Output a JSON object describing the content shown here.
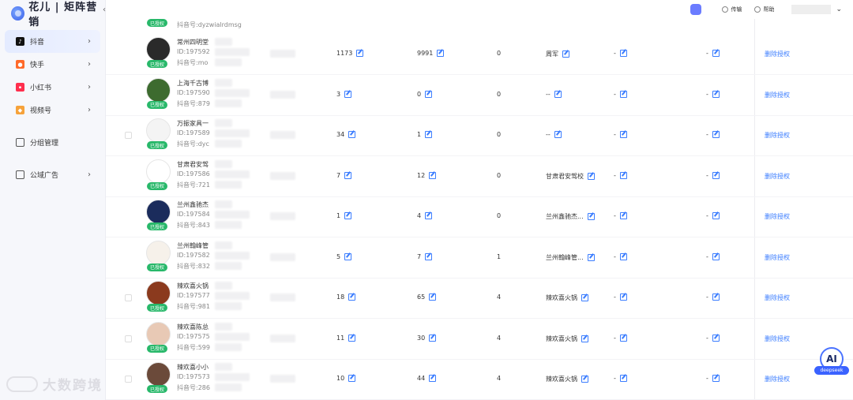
{
  "brand": {
    "name": "花儿 | 矩阵营销"
  },
  "sidebar": {
    "items": [
      {
        "label": "抖音",
        "icon": "douyin-icon",
        "active": true
      },
      {
        "label": "快手",
        "icon": "kuaishou-icon",
        "active": false
      },
      {
        "label": "小红书",
        "icon": "xiaohongshu-icon",
        "active": false
      },
      {
        "label": "视频号",
        "icon": "video-channel-icon",
        "active": false
      },
      {
        "label": "分组管理",
        "icon": "group-icon",
        "active": false
      },
      {
        "label": "公域广告",
        "icon": "ad-icon",
        "active": false
      }
    ]
  },
  "header": {
    "btn1": "传输",
    "btn2": "帮助"
  },
  "table": {
    "top_partial": {
      "badge": "已授权",
      "dy": "抖音号:dyzwialrdmsg"
    },
    "rows": [
      {
        "nick": "常州四明堂",
        "id": "ID:197592",
        "dy": "抖音号:mo",
        "c1": "1173",
        "c2": "9991",
        "c3": "0",
        "c4": "周军",
        "c5": "-",
        "c6": "-",
        "badge": "已授权",
        "action": "删除授权"
      },
      {
        "nick": "上海千古博",
        "id": "ID:197590",
        "dy": "抖音号:879",
        "c1": "3",
        "c2": "0",
        "c3": "0",
        "c4": "--",
        "c5": "-",
        "c6": "-",
        "badge": "已授权",
        "action": "删除授权"
      },
      {
        "nick": "万振家具一",
        "id": "ID:197589",
        "dy": "抖音号:dyc",
        "c1": "34",
        "c2": "1",
        "c3": "0",
        "c4": "--",
        "c5": "-",
        "c6": "-",
        "badge": "已授权",
        "action": "删除授权"
      },
      {
        "nick": "甘肃君安驾",
        "id": "ID:197586",
        "dy": "抖音号:721",
        "c1": "7",
        "c2": "12",
        "c3": "0",
        "c4": "甘肃君安驾校",
        "c5": "-",
        "c6": "-",
        "badge": "已授权",
        "action": "删除授权"
      },
      {
        "nick": "兰州鑫驰杰",
        "id": "ID:197584",
        "dy": "抖音号:843",
        "c1": "1",
        "c2": "4",
        "c3": "0",
        "c4": "兰州鑫驰杰...",
        "c5": "-",
        "c6": "-",
        "badge": "已授权",
        "action": "删除授权"
      },
      {
        "nick": "兰州翰峰管",
        "id": "ID:197582",
        "dy": "抖音号:832",
        "c1": "5",
        "c2": "7",
        "c3": "1",
        "c4": "兰州翰峰管...",
        "c5": "-",
        "c6": "-",
        "badge": "已授权",
        "action": "删除授权"
      },
      {
        "nick": "辣欢喜火锅",
        "id": "ID:197577",
        "dy": "抖音号:981",
        "c1": "18",
        "c2": "65",
        "c3": "4",
        "c4": "辣欢喜火锅",
        "c5": "-",
        "c6": "-",
        "badge": "已授权",
        "action": "删除授权"
      },
      {
        "nick": "辣欢喜陈总",
        "id": "ID:197575",
        "dy": "抖音号:599",
        "c1": "11",
        "c2": "30",
        "c3": "4",
        "c4": "辣欢喜火锅",
        "c5": "-",
        "c6": "-",
        "badge": "已授权",
        "action": "删除授权"
      },
      {
        "nick": "辣欢喜小小",
        "id": "ID:197573",
        "dy": "抖音号:286",
        "c1": "10",
        "c2": "44",
        "c3": "4",
        "c4": "辣欢喜火锅",
        "c5": "-",
        "c6": "-",
        "badge": "已授权",
        "action": "删除授权"
      }
    ]
  },
  "watermark": {
    "text": "大数跨境"
  },
  "ai": {
    "label": "AI",
    "tag": "deepseek"
  },
  "colors": {
    "accent": "#3b7dff",
    "badge": "#28b86a"
  }
}
